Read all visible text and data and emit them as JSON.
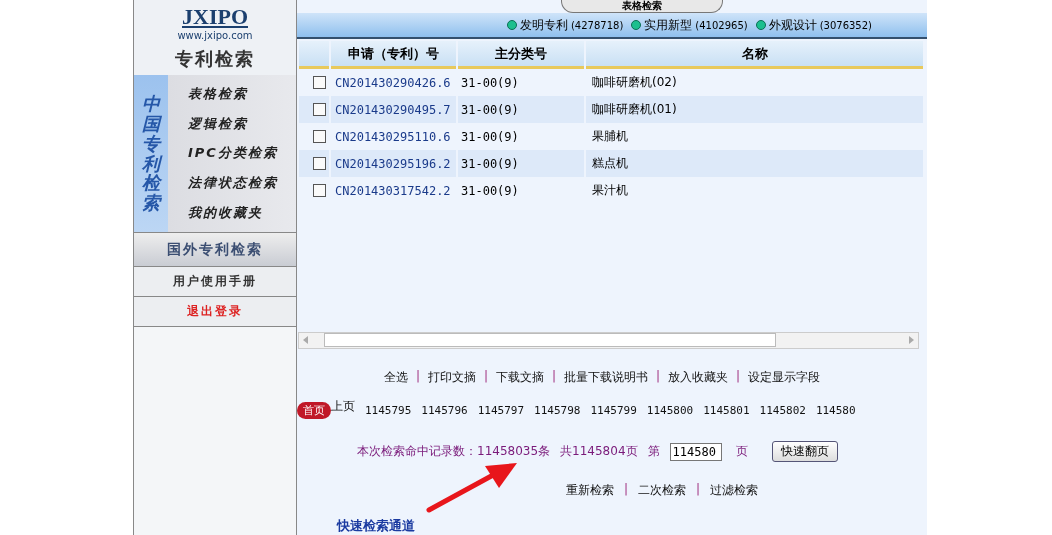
{
  "logo": {
    "title": "JXIPO",
    "url": "www.jxipo.com",
    "subtitle": "专利检索"
  },
  "sidebar": {
    "group_label": "中国专利检索",
    "items": [
      {
        "label": "表格检索",
        "selected": false
      },
      {
        "label": "逻辑检索",
        "selected": false
      },
      {
        "label": "IPC分类检索",
        "selected": false
      },
      {
        "label": "法律状态检索",
        "selected": false
      },
      {
        "label": "我的收藏夹",
        "selected": false
      }
    ],
    "sections": [
      {
        "label": "国外专利检索",
        "kind": "header"
      },
      {
        "label": "用户使用手册",
        "kind": "link"
      },
      {
        "label": "退出登录",
        "kind": "logout"
      }
    ]
  },
  "top_tab": "表格检索",
  "legend": [
    {
      "label": "发明专利",
      "count": "(4278718)"
    },
    {
      "label": "实用新型",
      "count": "(4102965)"
    },
    {
      "label": "外观设计",
      "count": "(3076352)"
    }
  ],
  "table": {
    "columns": [
      "申请（专利）号",
      "主分类号",
      "名称"
    ],
    "rows": [
      {
        "checked": false,
        "number": "CN201430290426.6",
        "class": "31-00(9)",
        "name": "咖啡研磨机(02)"
      },
      {
        "checked": false,
        "number": "CN201430290495.7",
        "class": "31-00(9)",
        "name": "咖啡研磨机(01)"
      },
      {
        "checked": false,
        "number": "CN201430295110.6",
        "class": "31-00(9)",
        "name": "果脯机"
      },
      {
        "checked": false,
        "number": "CN201430295196.2",
        "class": "31-00(9)",
        "name": "糕点机"
      },
      {
        "checked": false,
        "number": "CN201430317542.2",
        "class": "31-00(9)",
        "name": "果汁机"
      }
    ]
  },
  "separator": "|",
  "actions": [
    "全选",
    "打印文摘",
    "下载文摘",
    "批量下载说明书",
    "放入收藏夹",
    "设定显示字段"
  ],
  "pager": {
    "first": "首页",
    "prev": "上页",
    "pages": [
      "1145795",
      "1145796",
      "1145797",
      "1145798",
      "1145799",
      "1145800",
      "1145801",
      "1145802",
      "114580"
    ]
  },
  "stats": {
    "records_label": "本次检索命中记录数：",
    "records": "11458035条",
    "pages": "共1145804页",
    "page_prefix": "第",
    "page_value": "114580",
    "page_suffix": "页",
    "go_button": "快速翻页"
  },
  "search_links": [
    "重新检索",
    "二次检索",
    "过滤检索"
  ],
  "quick_title": "快速检索通道"
}
